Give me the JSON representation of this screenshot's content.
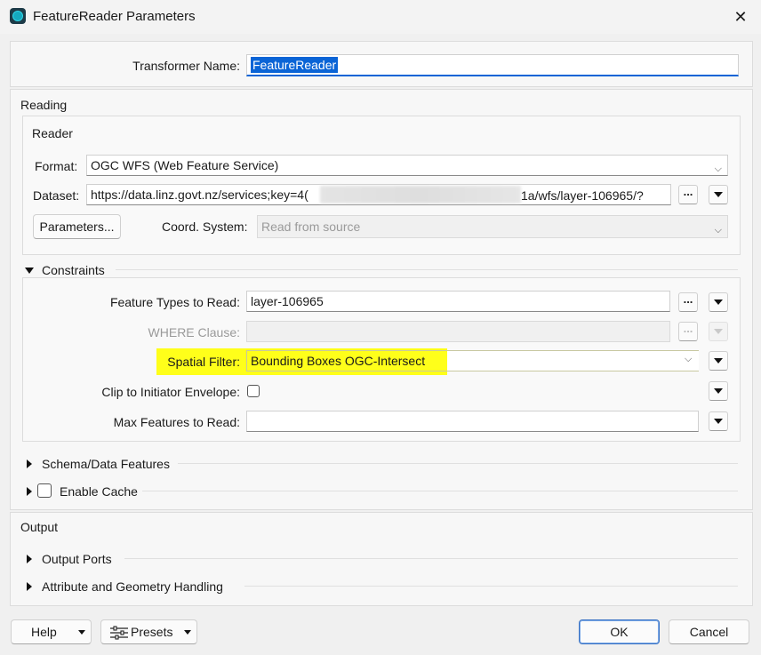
{
  "window": {
    "title": "FeatureReader Parameters",
    "close_glyph": "✕"
  },
  "transformer": {
    "label": "Transformer Name:",
    "value": "FeatureReader"
  },
  "reading": {
    "group_title": "Reading",
    "reader": {
      "group_title": "Reader",
      "format_label": "Format:",
      "format_value": "OGC WFS (Web Feature Service)",
      "dataset_label": "Dataset:",
      "dataset_prefix": "https://data.linz.govt.nz/services;key=4(",
      "dataset_suffix": "1a/wfs/layer-106965/?",
      "parameters_button": "Parameters...",
      "coord_label": "Coord. System:",
      "coord_placeholder": "Read from source"
    },
    "constraints": {
      "title": "Constraints",
      "feature_types_label": "Feature Types to Read:",
      "feature_types_value": "layer-106965",
      "where_label": "WHERE Clause:",
      "where_value": "",
      "spatial_filter_label": "Spatial Filter:",
      "spatial_filter_value": "Bounding Boxes OGC-Intersect",
      "clip_label": "Clip to Initiator Envelope:",
      "max_features_label": "Max Features to Read:",
      "max_features_value": ""
    },
    "schema_title": "Schema/Data Features",
    "cache_title": "Enable Cache"
  },
  "output": {
    "group_title": "Output",
    "ports_title": "Output Ports",
    "attr_title": "Attribute and Geometry Handling"
  },
  "footer": {
    "help": "Help",
    "presets": "Presets",
    "ok": "OK",
    "cancel": "Cancel"
  },
  "common": {
    "ellipsis": "...",
    "chevron": "⌵"
  },
  "colors": {
    "highlight": "#ffff1a",
    "selection": "#0a64d6",
    "accent_border": "#3a73c4"
  }
}
